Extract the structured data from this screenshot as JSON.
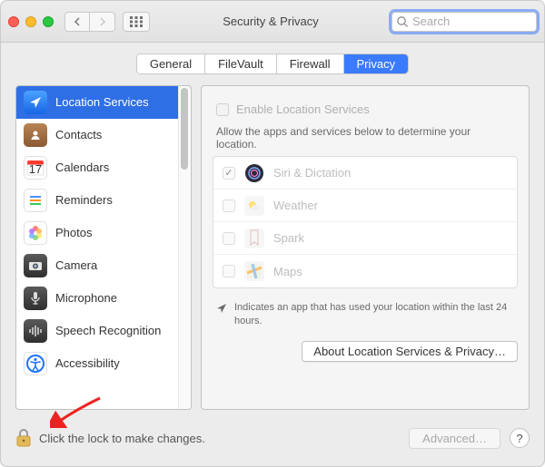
{
  "window": {
    "title": "Security & Privacy"
  },
  "search": {
    "placeholder": "Search"
  },
  "tabs": [
    {
      "label": "General",
      "active": false
    },
    {
      "label": "FileVault",
      "active": false
    },
    {
      "label": "Firewall",
      "active": false
    },
    {
      "label": "Privacy",
      "active": true
    }
  ],
  "categories": [
    {
      "label": "Location Services",
      "selected": true,
      "icon": "location"
    },
    {
      "label": "Contacts",
      "icon": "contacts"
    },
    {
      "label": "Calendars",
      "icon": "calendar"
    },
    {
      "label": "Reminders",
      "icon": "reminders"
    },
    {
      "label": "Photos",
      "icon": "photos"
    },
    {
      "label": "Camera",
      "icon": "camera"
    },
    {
      "label": "Microphone",
      "icon": "microphone"
    },
    {
      "label": "Speech Recognition",
      "icon": "speech"
    },
    {
      "label": "Accessibility",
      "icon": "accessibility"
    }
  ],
  "detail": {
    "enable_label": "Enable Location Services",
    "enable_checked": false,
    "allow_label": "Allow the apps and services below to determine your location.",
    "apps": [
      {
        "label": "Siri & Dictation",
        "checked": true,
        "icon": "siri"
      },
      {
        "label": "Weather",
        "checked": false,
        "icon": "weather"
      },
      {
        "label": "Spark",
        "checked": false,
        "icon": "spark"
      },
      {
        "label": "Maps",
        "checked": false,
        "icon": "maps"
      }
    ],
    "recent_note": "Indicates an app that has used your location within the last 24 hours.",
    "about_button": "About Location Services & Privacy…"
  },
  "footer": {
    "lock_text": "Click the lock to make changes.",
    "advanced_button": "Advanced…",
    "help_button": "?"
  }
}
